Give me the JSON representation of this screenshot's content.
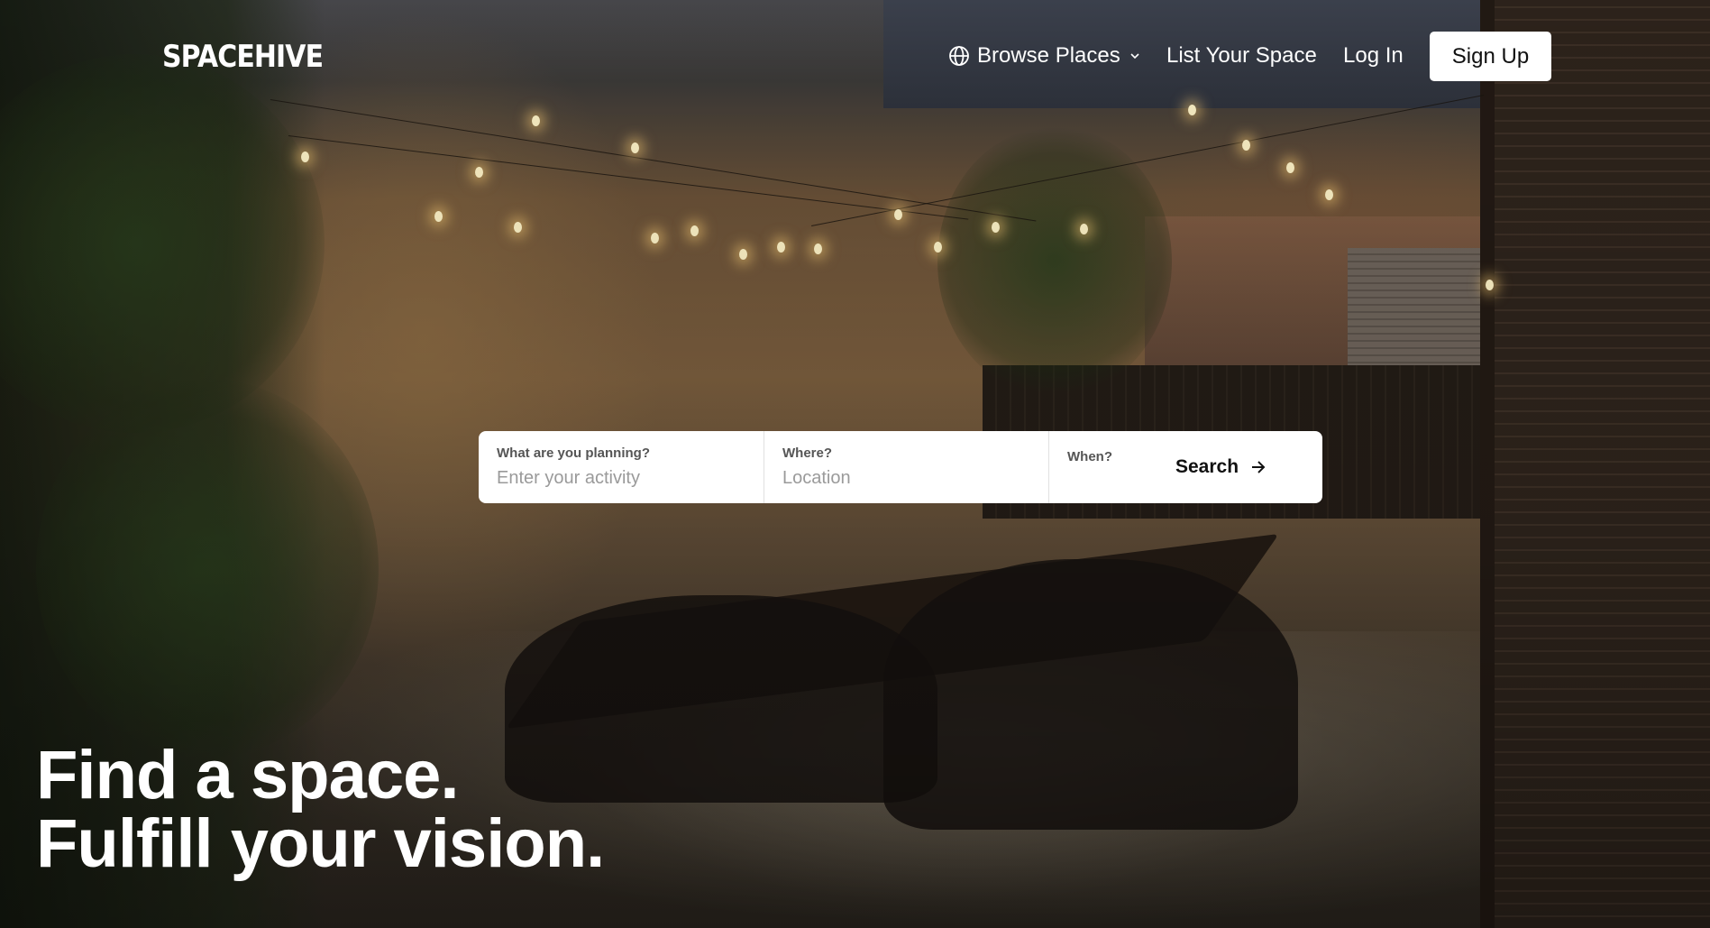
{
  "brand": {
    "logo_text": "SPACEHIVE"
  },
  "nav": {
    "browse_label": "Browse Places",
    "list_label": "List Your Space",
    "login_label": "Log In",
    "signup_label": "Sign Up"
  },
  "search": {
    "what_label": "What are you planning?",
    "what_placeholder": "Enter your activity",
    "where_label": "Where?",
    "where_placeholder": "Location",
    "when_label": "When?",
    "button_label": "Search"
  },
  "hero": {
    "headline_line1": "Find a space.",
    "headline_line2": "Fulfill your vision."
  },
  "colors": {
    "nav_text": "#ffffff",
    "signup_bg": "#ffffff",
    "signup_text": "#111111",
    "search_bg": "#ffffff"
  },
  "icons": {
    "browse": "globe-icon",
    "browse_dropdown": "chevron-down-icon",
    "search_button": "arrow-right-icon"
  }
}
